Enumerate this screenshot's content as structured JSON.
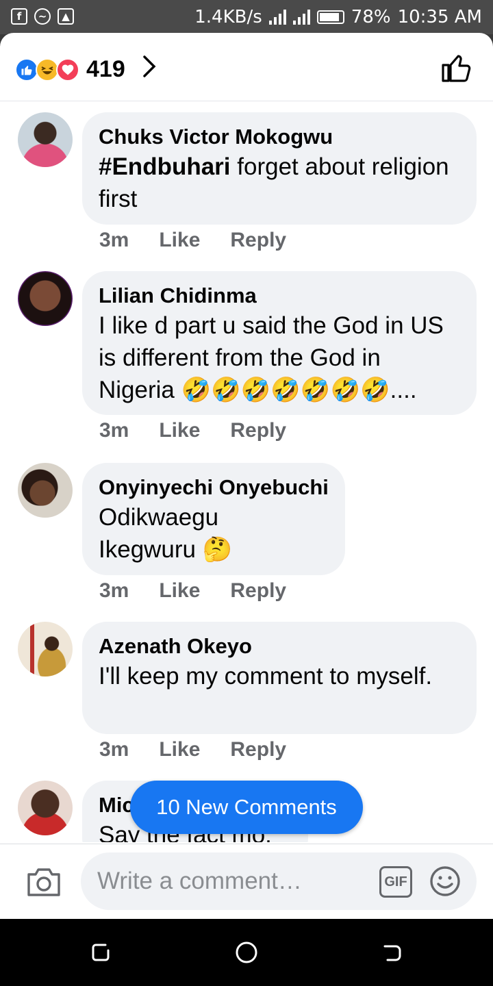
{
  "status_bar": {
    "left_icons": [
      "facebook-icon",
      "messenger-icon",
      "image-icon"
    ],
    "speed": "1.4KB/s",
    "battery": "78%",
    "time": "10:35 AM"
  },
  "reactions": {
    "types": [
      "like",
      "haha",
      "love"
    ],
    "count": "419"
  },
  "comments": [
    {
      "name": "Chuks Victor Mokogwu",
      "text_bold": "#Endbuhari",
      "text": " forget about religion first",
      "time": "3m",
      "like": "Like",
      "reply": "Reply"
    },
    {
      "name": "Lilian Chidinma",
      "text": "I like d part u said the God in US is different from the God in Nigeria 🤣🤣🤣🤣🤣🤣🤣....",
      "time": "3m",
      "like": "Like",
      "reply": "Reply"
    },
    {
      "name": "Onyinyechi Onyebuchi",
      "text": "Odikwaegu Ikegwuru 🤔",
      "time": "3m",
      "like": "Like",
      "reply": "Reply"
    },
    {
      "name": "Azenath Okeyo",
      "text": "I'll keep my comment to myself.",
      "time": "3m",
      "like": "Like",
      "reply": "Reply"
    },
    {
      "name": "Mic",
      "text": "Say the fact mo."
    }
  ],
  "new_comments_label": "10 New Comments",
  "composer": {
    "placeholder": "Write a comment…",
    "gif_label": "GIF"
  },
  "colors": {
    "accent": "#1877f2",
    "bubble": "#f0f2f5",
    "meta_text": "#65676b"
  }
}
